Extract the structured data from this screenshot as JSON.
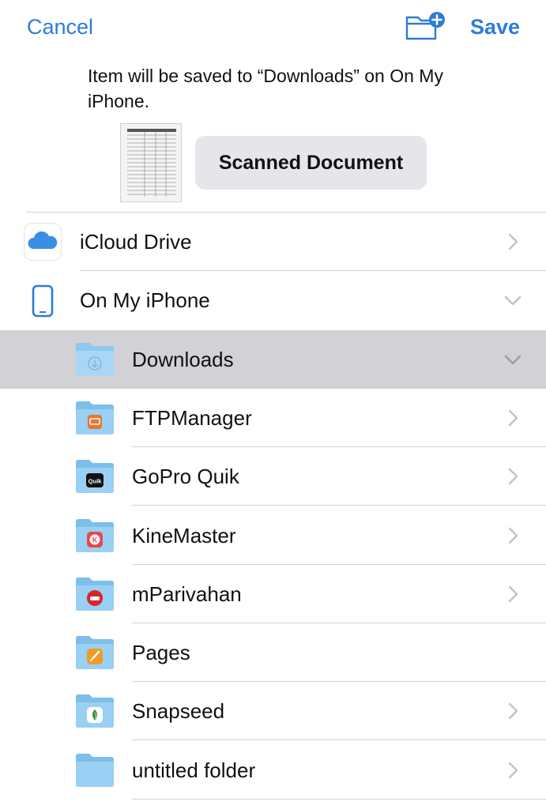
{
  "nav": {
    "cancel_label": "Cancel",
    "save_label": "Save",
    "new_folder_icon": "folder-plus-icon"
  },
  "info": {
    "message": "Item will be saved to “Downloads” on On My iPhone.",
    "file_name": "Scanned Document"
  },
  "locations": [
    {
      "label": "iCloud Drive",
      "icon": "icloud-icon",
      "chevron": "right"
    },
    {
      "label": "On My iPhone",
      "icon": "iphone-icon",
      "chevron": "down"
    }
  ],
  "folders": [
    {
      "label": "Downloads",
      "badge": "download-icon",
      "chevron": "down",
      "selected": true
    },
    {
      "label": "FTPManager",
      "badge": "ftpmanager-app-icon",
      "chevron": "right"
    },
    {
      "label": "GoPro Quik",
      "badge": "gopro-quik-app-icon",
      "badge_text": "Quik",
      "chevron": "right"
    },
    {
      "label": "KineMaster",
      "badge": "kinemaster-app-icon",
      "chevron": "right"
    },
    {
      "label": "mParivahan",
      "badge": "mparivahan-app-icon",
      "chevron": "right"
    },
    {
      "label": "Pages",
      "badge": "pages-app-icon",
      "chevron": "none"
    },
    {
      "label": "Snapseed",
      "badge": "snapseed-app-icon",
      "chevron": "right"
    },
    {
      "label": "untitled folder",
      "badge": "none",
      "chevron": "right"
    }
  ],
  "colors": {
    "accent": "#2f7bd8",
    "folder": "#8cc8ef",
    "selected_row": "#d1d1d6"
  }
}
